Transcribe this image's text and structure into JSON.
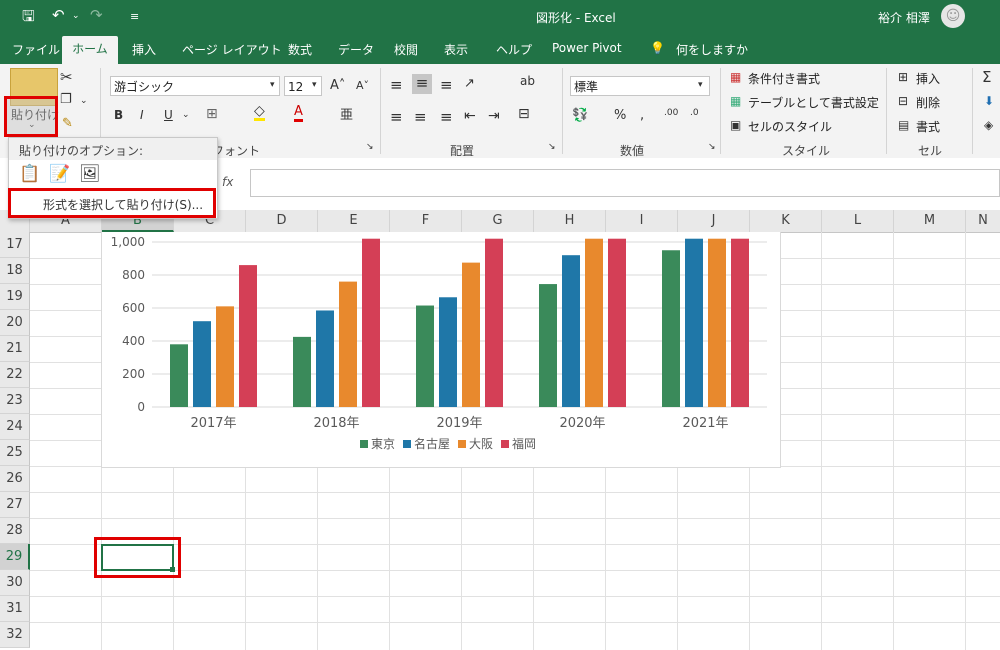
{
  "titlebar": {
    "title": "図形化  -  Excel",
    "user": "裕介 相澤",
    "bg_color": "#217346"
  },
  "tabs": [
    {
      "label": "ファイル"
    },
    {
      "label": "ホーム",
      "active": true
    },
    {
      "label": "挿入"
    },
    {
      "label": "ページ レイアウト"
    },
    {
      "label": "数式"
    },
    {
      "label": "データ"
    },
    {
      "label": "校閲"
    },
    {
      "label": "表示"
    },
    {
      "label": "ヘルプ"
    },
    {
      "label": "Power Pivot"
    },
    {
      "label": "何をしますか"
    }
  ],
  "ribbon": {
    "paste_label": "貼り付け",
    "font_name": "游ゴシック",
    "font_size": "12",
    "font_group": "フォント",
    "align_group": "配置",
    "number_format": "標準",
    "number_group": "数値",
    "conditional_format": "条件付き書式",
    "table_format": "テーブルとして書式設定",
    "cell_style": "セルのスタイル",
    "style_group": "スタイル",
    "insert": "挿入",
    "delete": "削除",
    "format": "書式",
    "cells_group": "セル"
  },
  "paste_menu": {
    "header": "貼り付けのオプション:",
    "special": "形式を選択して貼り付け(S)..."
  },
  "formula_bar": {
    "fx": "fx",
    "value": ""
  },
  "columns": [
    "A",
    "B",
    "C",
    "D",
    "E",
    "F",
    "G",
    "H",
    "I",
    "J",
    "K",
    "L",
    "M",
    "N"
  ],
  "rows": [
    "17",
    "18",
    "19",
    "20",
    "21",
    "22",
    "23",
    "24",
    "25",
    "26",
    "27",
    "28",
    "29",
    "30",
    "31",
    "32"
  ],
  "highlight_color": "#e00000",
  "chart_data": {
    "type": "bar",
    "categories": [
      "2017年",
      "2018年",
      "2019年",
      "2020年",
      "2021年"
    ],
    "series": [
      {
        "name": "東京",
        "color": "#3a8a5a",
        "values": [
          380,
          425,
          615,
          745,
          950
        ]
      },
      {
        "name": "名古屋",
        "color": "#1f77a8",
        "values": [
          520,
          585,
          665,
          920,
          1050
        ]
      },
      {
        "name": "大阪",
        "color": "#e8892d",
        "values": [
          610,
          760,
          875,
          1050,
          1050
        ]
      },
      {
        "name": "福岡",
        "color": "#d43f56",
        "values": [
          860,
          1040,
          1050,
          1050,
          1050
        ]
      }
    ],
    "yticks": [
      "0",
      "200",
      "400",
      "600",
      "800",
      "1,000"
    ],
    "ylim": [
      0,
      1000
    ],
    "grid": true,
    "legend": "bottom"
  }
}
